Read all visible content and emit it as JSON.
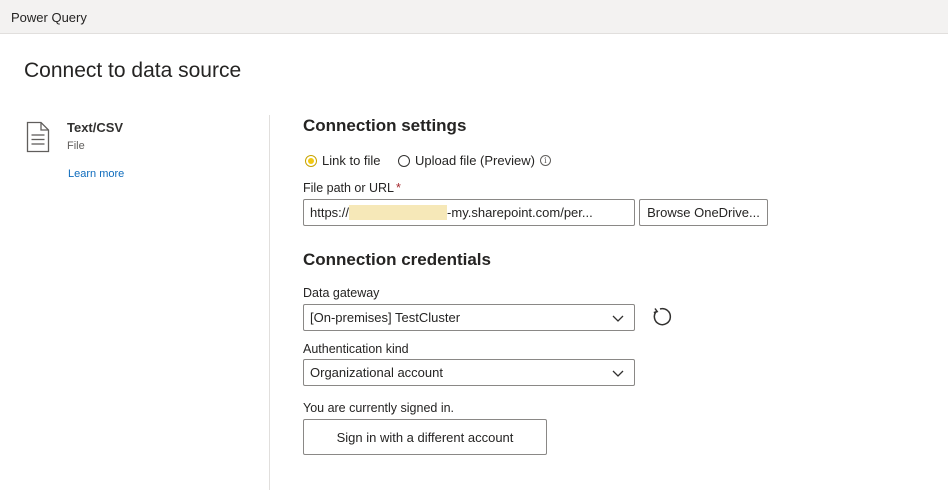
{
  "app": {
    "title": "Power Query"
  },
  "page": {
    "title": "Connect to data source"
  },
  "connector": {
    "name": "Text/CSV",
    "type": "File",
    "learn_more": "Learn more",
    "icon": "document-icon"
  },
  "connection_settings": {
    "title": "Connection settings",
    "options": [
      {
        "label": "Link to file",
        "selected": true
      },
      {
        "label": "Upload file (Preview)",
        "selected": false
      }
    ],
    "file_path": {
      "label": "File path or URL",
      "required_mark": "*",
      "value_prefix": "https://",
      "value_suffix": "-my.sharepoint.com/per..."
    },
    "browse_label": "Browse OneDrive..."
  },
  "connection_credentials": {
    "title": "Connection credentials",
    "gateway": {
      "label": "Data gateway",
      "value": "[On-premises] TestCluster"
    },
    "auth": {
      "label": "Authentication kind",
      "value": "Organizational account"
    },
    "signed_in_text": "You are currently signed in.",
    "sign_in_button": "Sign in with a different account"
  },
  "colors": {
    "radio_selected": "#f2c811",
    "link": "#0f6cbd",
    "redaction": "#f6e8b8"
  }
}
